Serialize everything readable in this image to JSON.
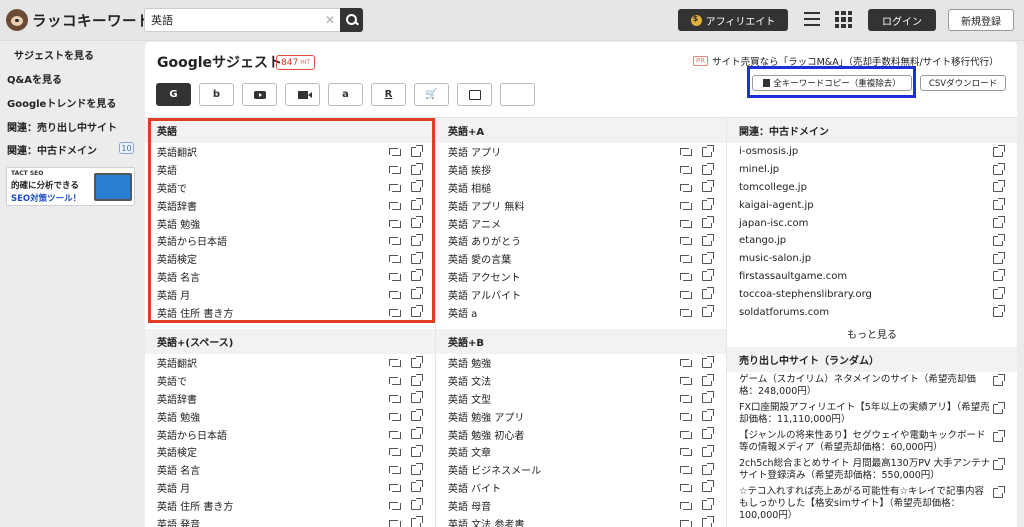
{
  "app": {
    "logo_text": "ラッコキーワード"
  },
  "search": {
    "value": "英語",
    "clear": "✕"
  },
  "header": {
    "affiliate": "アフィリエイト",
    "login": "ログイン",
    "signup": "新規登録"
  },
  "sidebar": {
    "items": [
      {
        "label": "サジェストを見る"
      },
      {
        "label": "Q&Aを見る"
      },
      {
        "label": "Googleトレンドを見る"
      },
      {
        "label": "関連：売り出し中サイト"
      },
      {
        "label": "関連：中古ドメイン",
        "badge": "10"
      }
    ],
    "banner": {
      "line1": "TACT SEO",
      "line2": "的確に分析できる",
      "line3": "SEO対策ツール！"
    }
  },
  "main": {
    "title": "Googleサジェスト",
    "hit_count": "847",
    "hit_unit": "HIT",
    "pr_tag": "PR",
    "pr_text": "サイト売買なら「ラッコM&A」（売却手数料無料/サイト移行代行）",
    "tabs": [
      {
        "icon": "google-icon",
        "label": "G"
      },
      {
        "icon": "bing-icon",
        "label": "b"
      },
      {
        "icon": "youtube-icon",
        "label": ""
      },
      {
        "icon": "video-icon",
        "label": ""
      },
      {
        "icon": "amazon-icon",
        "label": "a"
      },
      {
        "icon": "rakuten-icon",
        "label": "R"
      },
      {
        "icon": "cart-icon",
        "label": "🛒"
      },
      {
        "icon": "image-icon",
        "label": ""
      },
      {
        "icon": "apps-icon",
        "label": ""
      }
    ],
    "copy_all": "全キーワードコピー（重複除去）",
    "csv_download": "CSVダウンロード"
  },
  "col1": [
    {
      "header": "英語",
      "rows": [
        "英語翻訳",
        "英語",
        "英語で",
        "英語辞書",
        "英語 勉強",
        "英語から日本語",
        "英語検定",
        "英語 名言",
        "英語 月",
        "英語 住所 書き方"
      ]
    },
    {
      "header": "英語+(スペース)",
      "rows": [
        "英語翻訳",
        "英語で",
        "英語辞書",
        "英語 勉強",
        "英語から日本語",
        "英語検定",
        "英語 名言",
        "英語 月",
        "英語 住所 書き方",
        "英語 発音"
      ]
    }
  ],
  "col2": [
    {
      "header": "英語+A",
      "rows": [
        "英語 アプリ",
        "英語 挨拶",
        "英語 相槌",
        "英語 アプリ 無料",
        "英語 アニメ",
        "英語 ありがとう",
        "英語 愛の言葉",
        "英語 アクセント",
        "英語 アルバイト",
        "英語 a"
      ]
    },
    {
      "header": "英語+B",
      "rows": [
        "英語 勉強",
        "英語 文法",
        "英語 文型",
        "英語 勉強 アプリ",
        "英語 勉強 初心者",
        "英語 文章",
        "英語 ビジネスメール",
        "英語 バイト",
        "英語 母音",
        "英語 文法 参考書"
      ]
    }
  ],
  "col3": {
    "domains_header": "関連：中古ドメイン",
    "domains": [
      "i-osmosis.jp",
      "minel.jp",
      "tomcollege.jp",
      "kaigai-agent.jp",
      "japan-isc.com",
      "etango.jp",
      "music-salon.jp",
      "firstassaultgame.com",
      "toccoa-stephenslibrary.org",
      "soldatforums.com"
    ],
    "more": "もっと見る",
    "sites_header": "売り出し中サイト（ランダム）",
    "sites": [
      "ゲーム（スカイリム）ネタメインのサイト（希望売却価格：248,000円）",
      "FX口座開設アフィリエイト【5年以上の実績アリ】（希望売却価格：11,110,000円）",
      "【ジャンルの将来性あり】セグウェイや電動キックボード等の情報メディア（希望売却価格：60,000円）",
      "2ch5ch総合まとめサイト 月間最高130万PV 大手アンテナサイト登録済み（希望売却価格：550,000円）",
      "☆テコ入れすれば売上あがる可能性有☆キレイで記事内容もしっかりした【格安simサイト】（希望売却価格：100,000円）"
    ]
  },
  "colors": {
    "highlight_red": "#e23c24",
    "highlight_blue": "#1f2fd8",
    "dark": "#333333"
  }
}
